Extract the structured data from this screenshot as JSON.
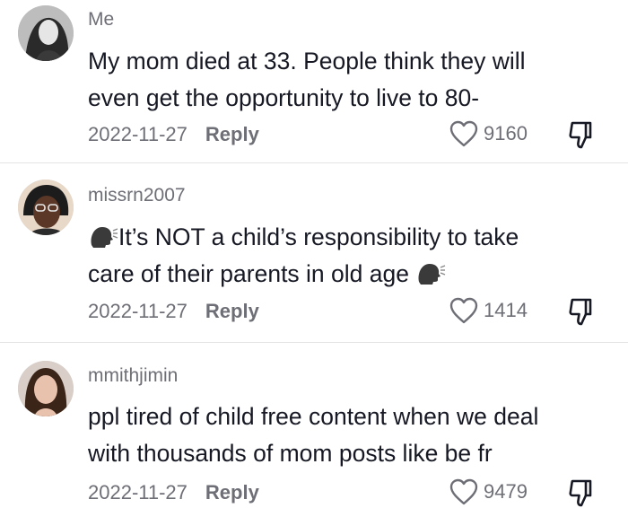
{
  "comments": [
    {
      "username": "Me",
      "line1": "My mom died at 33. People think they will",
      "line2": "even get the opportunity to live to 80-",
      "date": "2022-11-27",
      "reply_label": "Reply",
      "likes": "9160"
    },
    {
      "username": "missrn2007",
      "line1": "It’s NOT a child’s responsibility to take",
      "line2": "care of their parents in old age",
      "date": "2022-11-27",
      "reply_label": "Reply",
      "likes": "1414",
      "emoji": "speaking-head-emoji"
    },
    {
      "username": "mmithjimin",
      "line1": "ppl tired of child free content when we deal",
      "line2": "with thousands of mom posts like be fr",
      "date": "2022-11-27",
      "reply_label": "Reply",
      "likes": "9479"
    }
  ],
  "icons": {
    "like": "heart-outline-icon",
    "dislike": "thumbs-down-icon"
  },
  "colors": {
    "text": "#161823",
    "secondary": "#6e6f76",
    "divider": "#e3e3e4"
  }
}
